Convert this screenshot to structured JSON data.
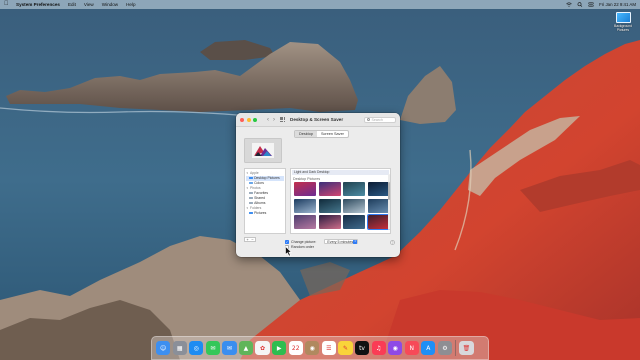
{
  "menubar": {
    "apple_icon": "apple-logo-icon",
    "app_name": "System Preferences",
    "menus": [
      "Edit",
      "View",
      "Window",
      "Help"
    ],
    "clock": "Fri Jan 22  9:41 AM"
  },
  "desktop": {
    "file_label": "Background Pictures"
  },
  "window": {
    "title": "Desktop & Screen Saver",
    "search_placeholder": "Search",
    "tabs": [
      {
        "label": "Desktop",
        "active": true
      },
      {
        "label": "Screen Saver",
        "active": false
      }
    ],
    "sidebar": {
      "groups": [
        {
          "label": "Apple",
          "items": [
            "Desktop Pictures",
            "Colors"
          ]
        },
        {
          "label": "Photos",
          "items": [
            "Favorites",
            "Shared",
            "Albums"
          ]
        },
        {
          "label": "Folders",
          "items": [
            "Pictures"
          ]
        }
      ],
      "add_label": "+",
      "remove_label": "−"
    },
    "content": {
      "fit_mode": "Light and Dark Desktop",
      "section_title": "Desktop Pictures",
      "thumbnails": [
        {
          "name": "big-sur-graphic",
          "colors": [
            "#c3304c",
            "#6b2c93"
          ]
        },
        {
          "name": "big-sur-abstract",
          "colors": [
            "#3a2f7a",
            "#d44672"
          ]
        },
        {
          "name": "big-sur-coast-dusk",
          "colors": [
            "#20414f",
            "#4d8da4"
          ]
        },
        {
          "name": "big-sur-night",
          "colors": [
            "#0c1c33",
            "#2b5b86"
          ]
        },
        {
          "name": "mountain-lake",
          "colors": [
            "#1c3c60",
            "#9cb5cf"
          ]
        },
        {
          "name": "rocky-shore",
          "colors": [
            "#102a3a",
            "#47788e"
          ]
        },
        {
          "name": "sea-cliffs",
          "colors": [
            "#2d4a5e",
            "#b5c6d2"
          ]
        },
        {
          "name": "catalina-island",
          "colors": [
            "#1e3d5c",
            "#6a8fb2"
          ]
        },
        {
          "name": "big-sur-road",
          "colors": [
            "#4d3d6e",
            "#b87aa2"
          ]
        },
        {
          "name": "cliff-sunset",
          "colors": [
            "#2a1c40",
            "#ce6e8a"
          ]
        },
        {
          "name": "ocean-rocks",
          "colors": [
            "#162c44",
            "#3f6b8d"
          ]
        },
        {
          "name": "red-coast",
          "colors": [
            "#3b1e2c",
            "#c9303c"
          ]
        }
      ],
      "selected_index": 11
    },
    "change_picture": {
      "checked": true,
      "label": "Change picture:",
      "interval": "Every 5 minutes"
    },
    "random_order": {
      "checked": false,
      "label": "Random order"
    },
    "help_label": "?"
  },
  "dock": {
    "apps": [
      {
        "name": "finder",
        "bg": "#3d8ff0",
        "glyph": "☺"
      },
      {
        "name": "launchpad",
        "bg": "#8a8f99",
        "glyph": "▦"
      },
      {
        "name": "safari",
        "bg": "#1d8cf2",
        "glyph": "◎"
      },
      {
        "name": "messages",
        "bg": "#34c759",
        "glyph": "✉"
      },
      {
        "name": "mail",
        "bg": "#3a8eef",
        "glyph": "✉"
      },
      {
        "name": "maps",
        "bg": "#5fb55a",
        "glyph": "▲"
      },
      {
        "name": "photos",
        "bg": "#f5f5f5",
        "glyph": "✿"
      },
      {
        "name": "facetime",
        "bg": "#2ebd4f",
        "glyph": "▶"
      },
      {
        "name": "calendar",
        "bg": "#ffffff",
        "glyph": "22"
      },
      {
        "name": "contacts",
        "bg": "#b0895f",
        "glyph": "◉"
      },
      {
        "name": "reminders",
        "bg": "#ffffff",
        "glyph": "☰"
      },
      {
        "name": "notes",
        "bg": "#f9d33a",
        "glyph": "✎"
      },
      {
        "name": "apple-tv",
        "bg": "#111111",
        "glyph": "tv"
      },
      {
        "name": "music",
        "bg": "#fa3c55",
        "glyph": "♫"
      },
      {
        "name": "podcasts",
        "bg": "#8e4ae6",
        "glyph": "◉"
      },
      {
        "name": "news",
        "bg": "#f74a58",
        "glyph": "N"
      },
      {
        "name": "app-store",
        "bg": "#1f8ff6",
        "glyph": "A"
      },
      {
        "name": "system-preferences",
        "bg": "#8e8e93",
        "glyph": "⚙"
      }
    ],
    "trash": {
      "name": "trash",
      "bg": "#d8d8dc",
      "glyph": "🗑"
    }
  }
}
